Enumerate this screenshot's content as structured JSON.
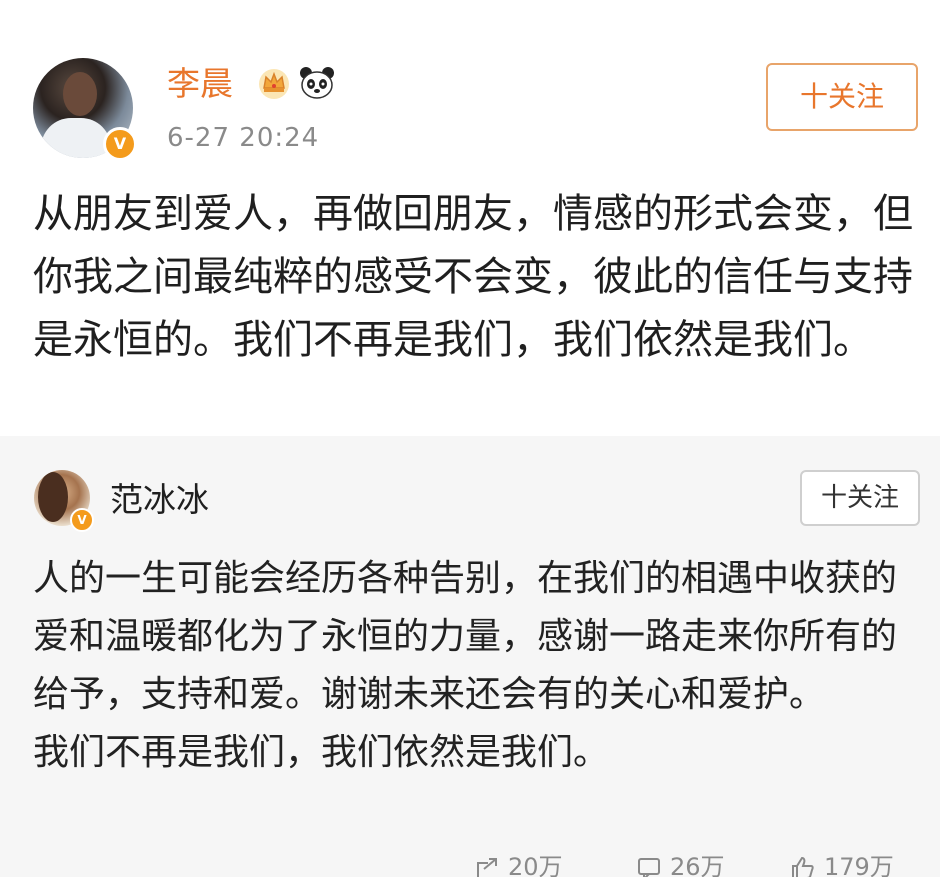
{
  "main_post": {
    "author": "李晨",
    "time": "6-27 20:24",
    "follow_label": "十关注",
    "text": "从朋友到爱人，再做回朋友，情感的形式会变，但你我之间最纯粹的感受不会变，彼此的信任与支持是永恒的。我们不再是我们，我们依然是我们。",
    "verified_badge": "V",
    "icons": [
      "crown-icon",
      "panda-icon"
    ]
  },
  "repost": {
    "author": "范冰冰",
    "follow_label": "十关注",
    "verified_badge": "V",
    "text_para1": "人的一生可能会经历各种告别，在我们的相遇中收获的爱和温暖都化为了永恒的力量，感谢一路走来你所有的给予，支持和爱。谢谢未来还会有的关心和爱护。",
    "text_para2": "我们不再是我们，我们依然是我们。"
  },
  "actions": {
    "share_count": "20万",
    "comment_count": "26万",
    "like_count": "179万"
  },
  "colors": {
    "brand_orange": "#e8762c",
    "follow_border": "#e8a46a",
    "verified": "#f49b1c",
    "repost_bg": "#f6f6f6"
  }
}
